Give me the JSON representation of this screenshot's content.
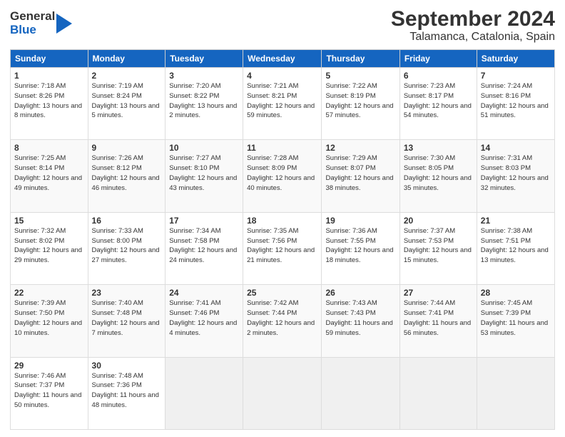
{
  "logo": {
    "general": "General",
    "blue": "Blue"
  },
  "header": {
    "title": "September 2024",
    "subtitle": "Talamanca, Catalonia, Spain"
  },
  "weekdays": [
    "Sunday",
    "Monday",
    "Tuesday",
    "Wednesday",
    "Thursday",
    "Friday",
    "Saturday"
  ],
  "weeks": [
    [
      {
        "day": "1",
        "sunrise": "7:18 AM",
        "sunset": "8:26 PM",
        "daylight": "13 hours and 8 minutes."
      },
      {
        "day": "2",
        "sunrise": "7:19 AM",
        "sunset": "8:24 PM",
        "daylight": "13 hours and 5 minutes."
      },
      {
        "day": "3",
        "sunrise": "7:20 AM",
        "sunset": "8:22 PM",
        "daylight": "13 hours and 2 minutes."
      },
      {
        "day": "4",
        "sunrise": "7:21 AM",
        "sunset": "8:21 PM",
        "daylight": "12 hours and 59 minutes."
      },
      {
        "day": "5",
        "sunrise": "7:22 AM",
        "sunset": "8:19 PM",
        "daylight": "12 hours and 57 minutes."
      },
      {
        "day": "6",
        "sunrise": "7:23 AM",
        "sunset": "8:17 PM",
        "daylight": "12 hours and 54 minutes."
      },
      {
        "day": "7",
        "sunrise": "7:24 AM",
        "sunset": "8:16 PM",
        "daylight": "12 hours and 51 minutes."
      }
    ],
    [
      {
        "day": "8",
        "sunrise": "7:25 AM",
        "sunset": "8:14 PM",
        "daylight": "12 hours and 49 minutes."
      },
      {
        "day": "9",
        "sunrise": "7:26 AM",
        "sunset": "8:12 PM",
        "daylight": "12 hours and 46 minutes."
      },
      {
        "day": "10",
        "sunrise": "7:27 AM",
        "sunset": "8:10 PM",
        "daylight": "12 hours and 43 minutes."
      },
      {
        "day": "11",
        "sunrise": "7:28 AM",
        "sunset": "8:09 PM",
        "daylight": "12 hours and 40 minutes."
      },
      {
        "day": "12",
        "sunrise": "7:29 AM",
        "sunset": "8:07 PM",
        "daylight": "12 hours and 38 minutes."
      },
      {
        "day": "13",
        "sunrise": "7:30 AM",
        "sunset": "8:05 PM",
        "daylight": "12 hours and 35 minutes."
      },
      {
        "day": "14",
        "sunrise": "7:31 AM",
        "sunset": "8:03 PM",
        "daylight": "12 hours and 32 minutes."
      }
    ],
    [
      {
        "day": "15",
        "sunrise": "7:32 AM",
        "sunset": "8:02 PM",
        "daylight": "12 hours and 29 minutes."
      },
      {
        "day": "16",
        "sunrise": "7:33 AM",
        "sunset": "8:00 PM",
        "daylight": "12 hours and 27 minutes."
      },
      {
        "day": "17",
        "sunrise": "7:34 AM",
        "sunset": "7:58 PM",
        "daylight": "12 hours and 24 minutes."
      },
      {
        "day": "18",
        "sunrise": "7:35 AM",
        "sunset": "7:56 PM",
        "daylight": "12 hours and 21 minutes."
      },
      {
        "day": "19",
        "sunrise": "7:36 AM",
        "sunset": "7:55 PM",
        "daylight": "12 hours and 18 minutes."
      },
      {
        "day": "20",
        "sunrise": "7:37 AM",
        "sunset": "7:53 PM",
        "daylight": "12 hours and 15 minutes."
      },
      {
        "day": "21",
        "sunrise": "7:38 AM",
        "sunset": "7:51 PM",
        "daylight": "12 hours and 13 minutes."
      }
    ],
    [
      {
        "day": "22",
        "sunrise": "7:39 AM",
        "sunset": "7:50 PM",
        "daylight": "12 hours and 10 minutes."
      },
      {
        "day": "23",
        "sunrise": "7:40 AM",
        "sunset": "7:48 PM",
        "daylight": "12 hours and 7 minutes."
      },
      {
        "day": "24",
        "sunrise": "7:41 AM",
        "sunset": "7:46 PM",
        "daylight": "12 hours and 4 minutes."
      },
      {
        "day": "25",
        "sunrise": "7:42 AM",
        "sunset": "7:44 PM",
        "daylight": "12 hours and 2 minutes."
      },
      {
        "day": "26",
        "sunrise": "7:43 AM",
        "sunset": "7:43 PM",
        "daylight": "11 hours and 59 minutes."
      },
      {
        "day": "27",
        "sunrise": "7:44 AM",
        "sunset": "7:41 PM",
        "daylight": "11 hours and 56 minutes."
      },
      {
        "day": "28",
        "sunrise": "7:45 AM",
        "sunset": "7:39 PM",
        "daylight": "11 hours and 53 minutes."
      }
    ],
    [
      {
        "day": "29",
        "sunrise": "7:46 AM",
        "sunset": "7:37 PM",
        "daylight": "11 hours and 50 minutes."
      },
      {
        "day": "30",
        "sunrise": "7:48 AM",
        "sunset": "7:36 PM",
        "daylight": "11 hours and 48 minutes."
      },
      null,
      null,
      null,
      null,
      null
    ]
  ]
}
